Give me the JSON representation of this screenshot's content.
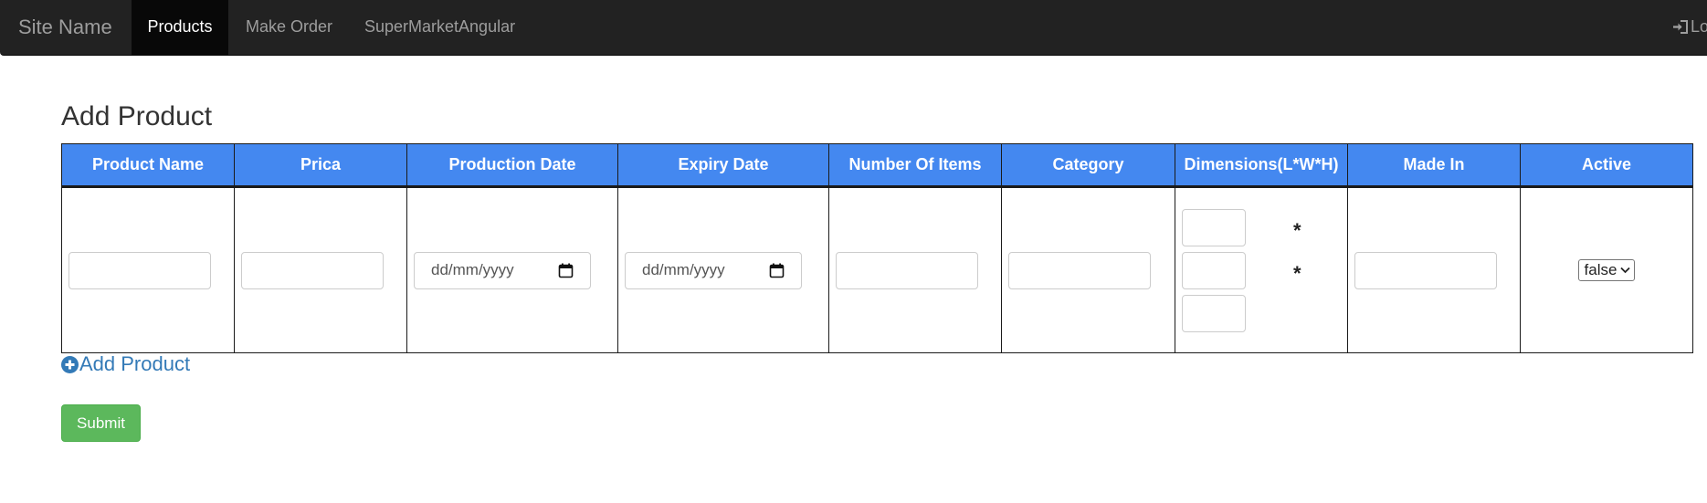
{
  "navbar": {
    "brand": "Site Name",
    "items": [
      {
        "label": "Products",
        "active": true
      },
      {
        "label": "Make Order",
        "active": false
      },
      {
        "label": "SuperMarketAngular",
        "active": false
      }
    ],
    "login_label": "Login",
    "login_icon": "sign-in-icon"
  },
  "page": {
    "title": "Add Product"
  },
  "table": {
    "headers": [
      "Product Name",
      "Prica",
      "Production Date",
      "Expiry Date",
      "Number Of Items",
      "Category",
      "Dimensions(L*W*H)",
      "Made In",
      "Active"
    ],
    "row": {
      "product_name": "",
      "price": "",
      "production_date_placeholder": "dd/mm/yyyy",
      "expiry_date_placeholder": "dd/mm/yyyy",
      "number_of_items": "",
      "category": "",
      "dimension_separator": "*",
      "made_in": "",
      "active_value": "false"
    }
  },
  "actions": {
    "add_product_label": "Add Product",
    "add_product_icon": "plus-circle-icon",
    "submit_label": "Submit"
  },
  "colors": {
    "navbar_bg": "#222222",
    "header_blue": "#4488f0",
    "link_blue": "#337ab7",
    "submit_green": "#5cb85c"
  }
}
